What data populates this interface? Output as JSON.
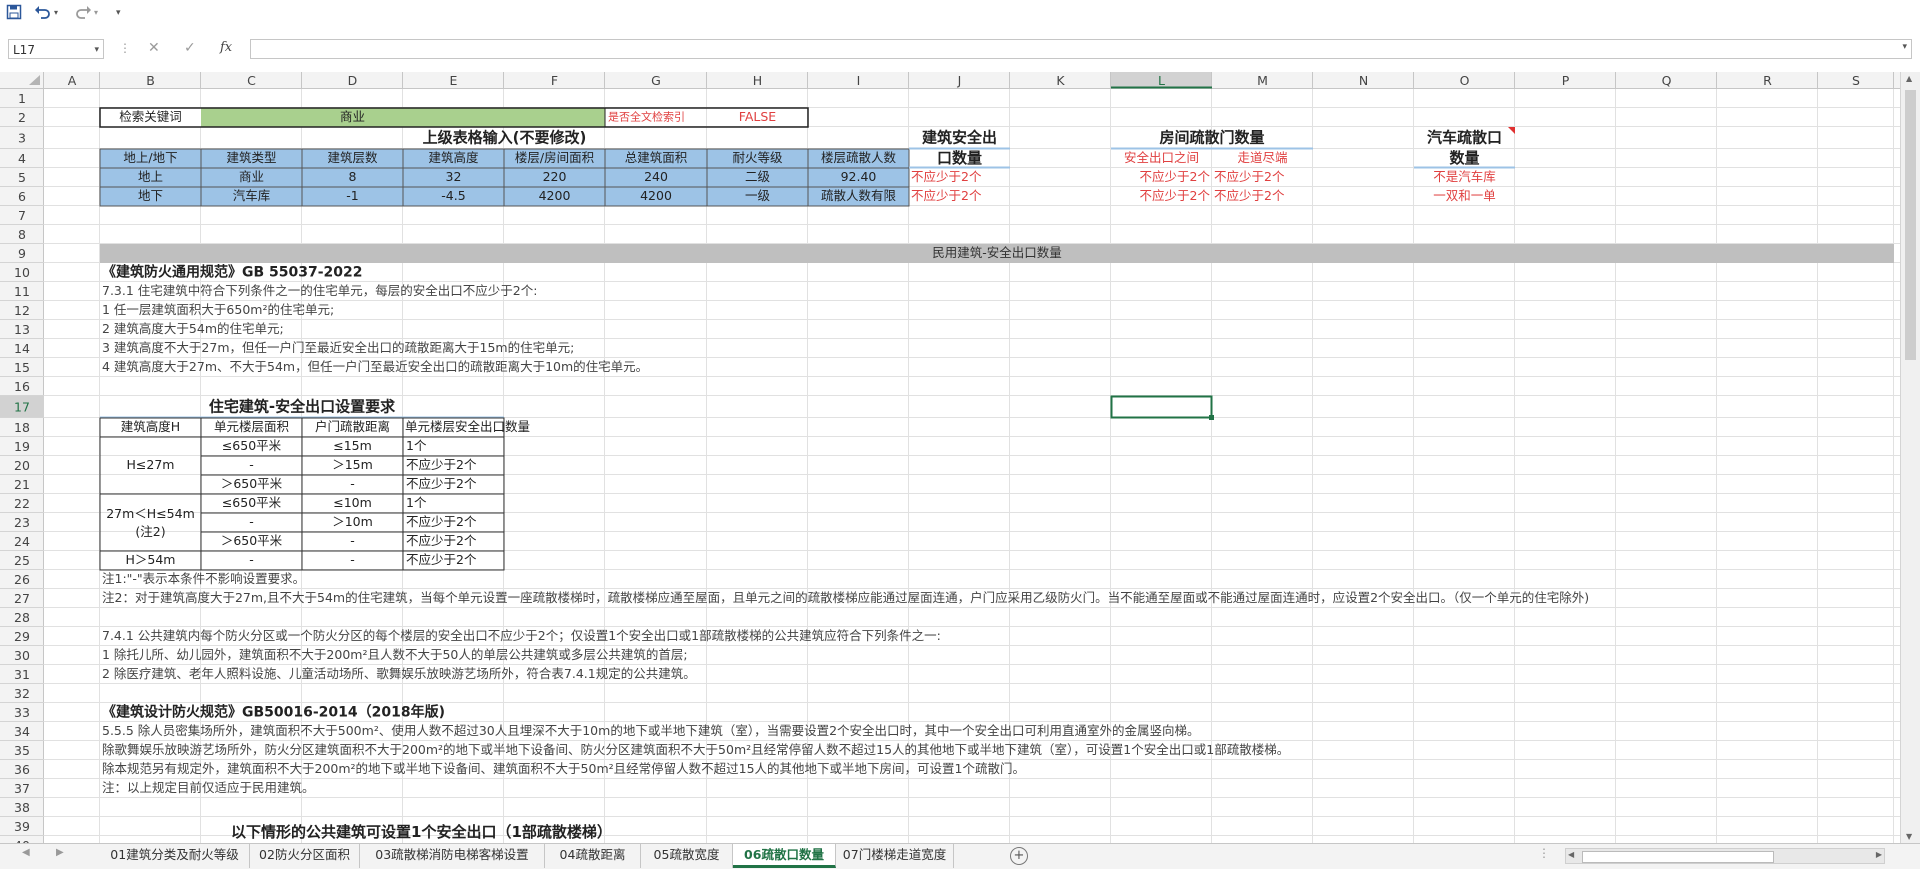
{
  "window": {
    "name_box": "L17",
    "formula_value": ""
  },
  "columns": [
    "A",
    "B",
    "C",
    "D",
    "E",
    "F",
    "G",
    "H",
    "I",
    "J",
    "K",
    "L",
    "M",
    "N",
    "O",
    "P",
    "Q",
    "R",
    "S"
  ],
  "selected_col": "L",
  "selected_row": "17",
  "header": {
    "row2": {
      "label": "检索关键词",
      "key2": "商业",
      "fulltext_label": "是否全文检索引",
      "fulltext_value": "FALSE"
    },
    "upper_title": "上级表格输入(不要修改)",
    "input_headers": [
      "地上/地下",
      "建筑类型",
      "建筑层数",
      "建筑高度",
      "楼层/房间面积",
      "总建筑面积",
      "耐火等级",
      "楼层疏散人数"
    ],
    "input_rows": [
      [
        "地上",
        "商业",
        "8",
        "32",
        "220",
        "240",
        "二级",
        "92.40"
      ],
      [
        "地下",
        "汽车库",
        "-1",
        "-4.5",
        "4200",
        "4200",
        "一级",
        "疏散人数有限"
      ]
    ],
    "safe_exit_title_l1": "建筑安全出",
    "safe_exit_title_l2": "口数量",
    "safe_exit_values": [
      "不应少于2个",
      "不应少于2个"
    ],
    "room_door_title": "房间疏散门数量",
    "room_door_sub": [
      "安全出口之间",
      "走道尽端"
    ],
    "room_door_values": [
      [
        "不应少于2个",
        "不应少于2个"
      ],
      [
        "不应少于2个",
        "不应少于2个"
      ]
    ],
    "car_exit_title_l1": "汽车疏散口",
    "car_exit_title_l2": "数量",
    "car_exit_values": [
      "不是汽车库",
      "一双和一单"
    ]
  },
  "section_band": "民用建筑-安全出口数量",
  "text_lines": {
    "r10": "《建筑防火通用规范》GB 55037-2022",
    "r11": "7.3.1 住宅建筑中符合下列条件之一的住宅单元，每层的安全出口不应少于2个:",
    "r12": "1 任一层建筑面积大于650m²的住宅单元;",
    "r13": "2 建筑高度大于54m的住宅单元;",
    "r14": "3 建筑高度不大于27m，但任一户门至最近安全出口的疏散距离大于15m的住宅单元;",
    "r15": "4 建筑高度大于27m、不大于54m，但任一户门至最近安全出口的疏散距离大于10m的住宅单元。",
    "r17": "住宅建筑-安全出口设置要求",
    "r26": "注1:\"-\"表示本条件不影响设置要求。",
    "r27": "注2：对于建筑高度大于27m,且不大于54m的住宅建筑，当每个单元设置一座疏散楼梯时，疏散楼梯应通至屋面，且单元之间的疏散楼梯应能通过屋面连通，户门应采用乙级防火门。当不能通至屋面或不能通过屋面连通时，应设置2个安全出口。（仅一个单元的住宅除外)",
    "r29": "7.4.1 公共建筑内每个防火分区或一个防火分区的每个楼层的安全出口不应少于2个；仅设置1个安全出口或1部疏散楼梯的公共建筑应符合下列条件之一:",
    "r30": "1 除托儿所、幼儿园外，建筑面积不大于200m²且人数不大于50人的单层公共建筑或多层公共建筑的首层;",
    "r31": "2 除医疗建筑、老年人照料设施、儿童活动场所、歌舞娱乐放映游艺场所外，符合表7.4.1规定的公共建筑。",
    "r33": "《建筑设计防火规范》GB50016-2014（2018年版)",
    "r34": "5.5.5 除人员密集场所外，建筑面积不大于500m²、使用人数不超过30人且埋深不大于10m的地下或半地下建筑（室），当需要设置2个安全出口时，其中一个安全出口可利用直通室外的金属竖向梯。",
    "r35": "除歌舞娱乐放映游艺场所外，防火分区建筑面积不大于200m²的地下或半地下设备间、防火分区建筑面积不大于50m²且经常停留人数不超过15人的其他地下或半地下建筑（室），可设置1个安全出口或1部疏散楼梯。",
    "r36": "除本规范另有规定外，建筑面积不大于200m²的地下或半地下设备间、建筑面积不大于50m²且经常停留人数不超过15人的其他地下或半地下房间，可设置1个疏散门。",
    "r37": "注：以上规定目前仅适应于民用建筑。",
    "r39": "以下情形的公共建筑可设置1个安全出口（1部疏散楼梯）"
  },
  "res_table": {
    "headers": [
      "建筑高度H",
      "单元楼层面积",
      "户门疏散距离",
      "单元楼层安全出口数量"
    ],
    "h_groups": [
      "H≤27m",
      "27m＜H≤54m",
      "(注2)",
      "H＞54m"
    ],
    "rows": [
      [
        "≤650平米",
        "≤15m",
        "1个"
      ],
      [
        "-",
        "＞15m",
        "不应少于2个"
      ],
      [
        "＞650平米",
        "-",
        "不应少于2个"
      ],
      [
        "≤650平米",
        "≤10m",
        "1个"
      ],
      [
        "-",
        "＞10m",
        "不应少于2个"
      ],
      [
        "＞650平米",
        "-",
        "不应少于2个"
      ],
      [
        "-",
        "-",
        "不应少于2个"
      ]
    ]
  },
  "sheet_tabs": [
    "01建筑分类及耐火等级",
    "02防火分区面积",
    "03疏散梯消防电梯客梯设置",
    "04疏散距离",
    "05疏散宽度",
    "06疏散口数量",
    "07门楼梯走道宽度"
  ],
  "active_tab": 5,
  "colors": {
    "blue_fill": "#9dc3e6",
    "green_fill": "#a9d08e",
    "red_text": "#e04040",
    "band_gray": "#bfbfbf",
    "excel_green": "#217346"
  }
}
